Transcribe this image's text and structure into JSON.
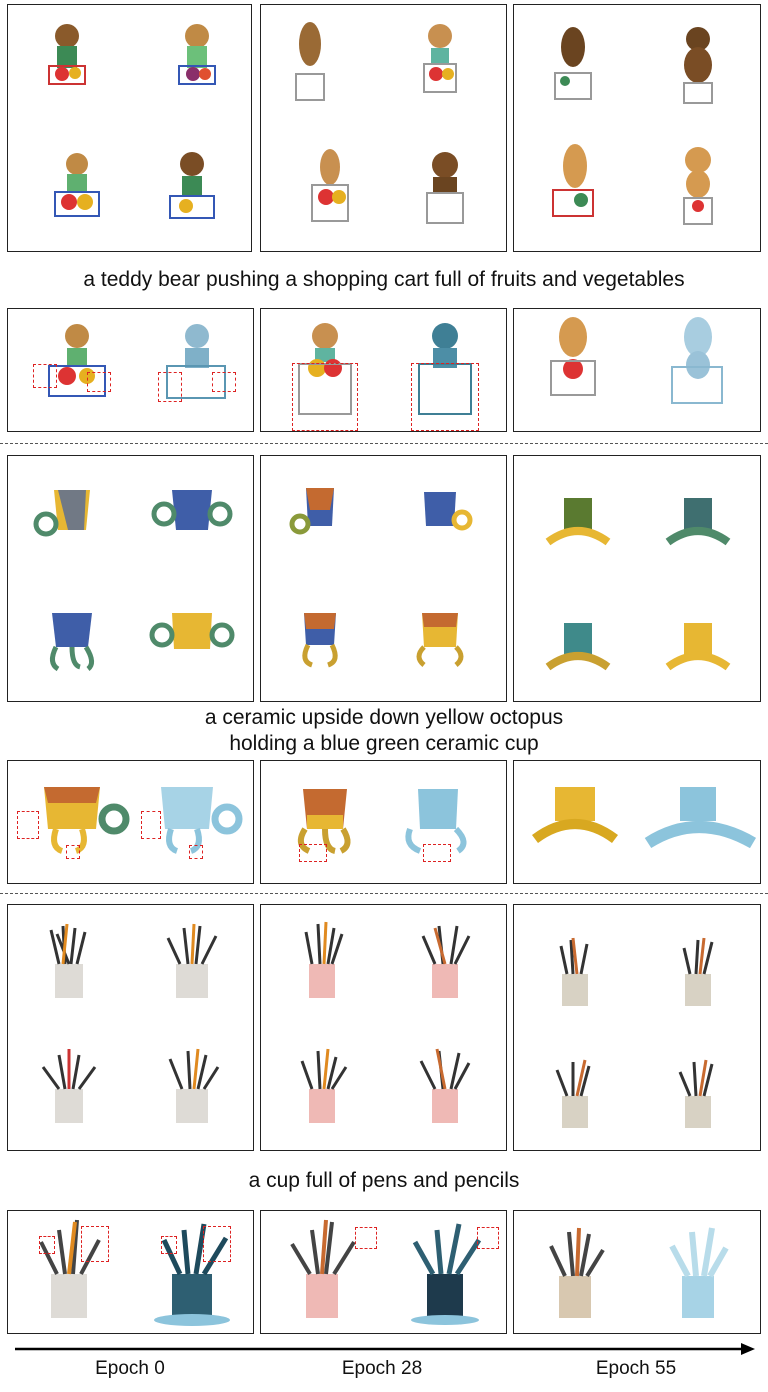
{
  "captions": {
    "bear": "a teddy bear pushing a shopping cart full of fruits and vegetables",
    "octopus_line1": "a ceramic upside down yellow octopus",
    "octopus_line2": "holding a blue green ceramic cup",
    "pencils": "a cup full of pens and pencils"
  },
  "epochs": [
    "Epoch 0",
    "Epoch 28",
    "Epoch 55"
  ],
  "colors": {
    "bear_fur": "#a8742f",
    "cart_red": "#c33",
    "cart_blue": "#3457b5",
    "normal_blue": "#7fb8d8",
    "octopus_yellow": "#e7b733",
    "octopus_green": "#4f8a6a",
    "cup_blue": "#3f5ea8",
    "mug_white": "#dedbd6",
    "mug_pink": "#efb9b5",
    "highlight_box": "#d22"
  }
}
